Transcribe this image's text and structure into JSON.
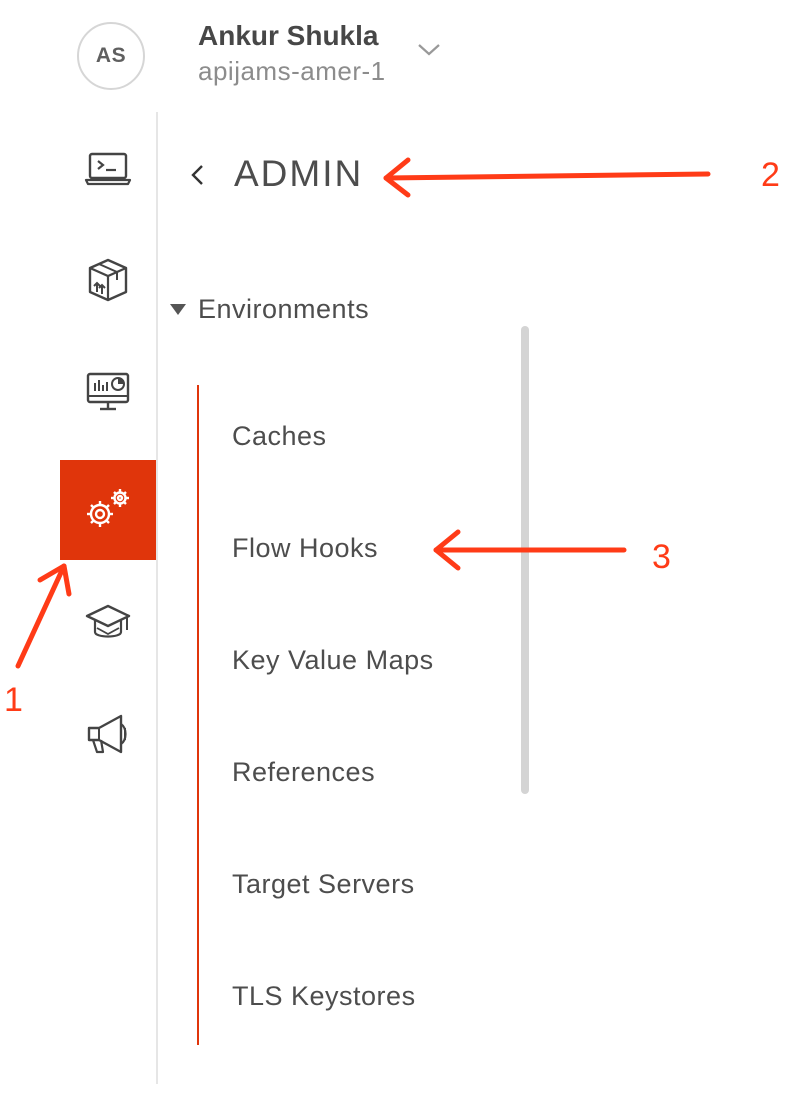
{
  "account": {
    "initials": "AS",
    "name": "Ankur Shukla",
    "org": "apijams-amer-1"
  },
  "rail": {
    "items": [
      {
        "icon": "terminal-laptop-icon"
      },
      {
        "icon": "package-box-icon"
      },
      {
        "icon": "analytics-monitor-icon"
      },
      {
        "icon": "admin-gears-icon",
        "active": true
      },
      {
        "icon": "graduation-cap-icon"
      },
      {
        "icon": "megaphone-icon"
      }
    ],
    "active_color": "#e0350b"
  },
  "panel": {
    "title": "ADMIN",
    "group": "Environments",
    "items": [
      "Caches",
      "Flow Hooks",
      "Key Value Maps",
      "References",
      "Target Servers",
      "TLS Keystores"
    ]
  },
  "annotations": {
    "color": "#ff3b17",
    "labels": [
      "1",
      "2",
      "3"
    ]
  }
}
